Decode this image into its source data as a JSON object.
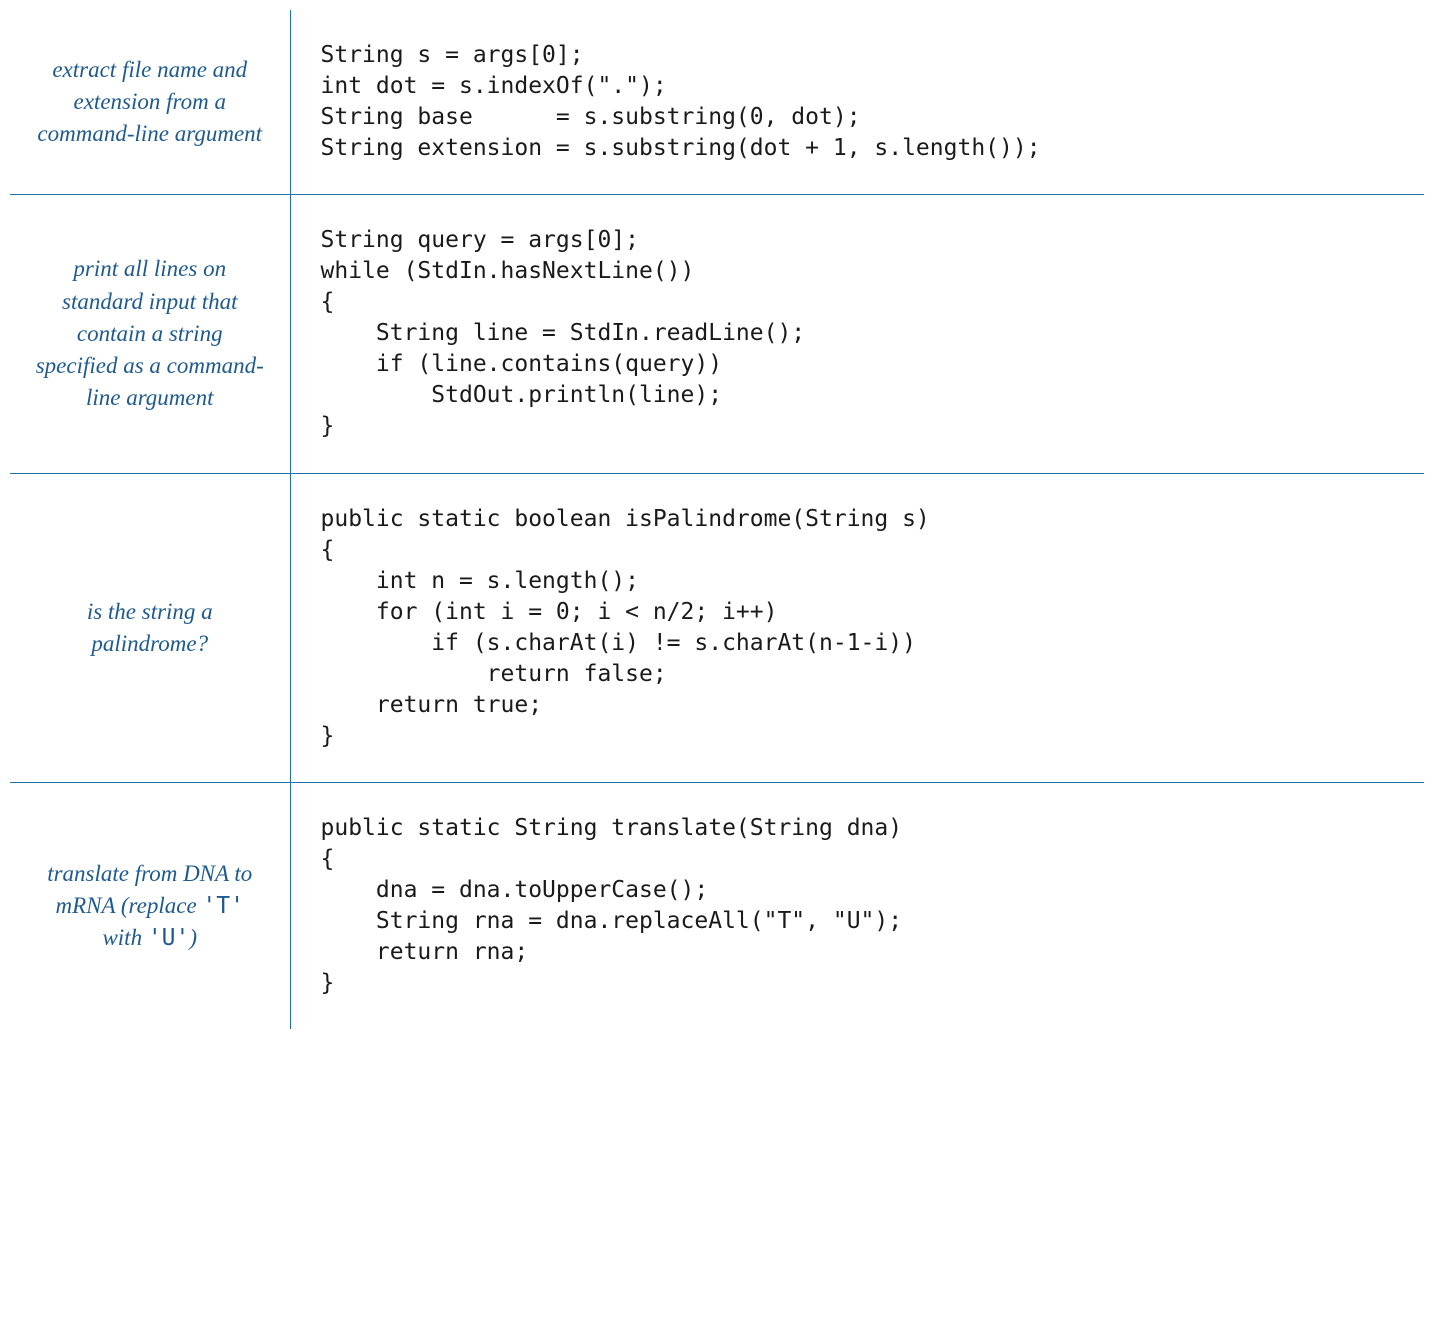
{
  "rows": [
    {
      "description": "extract file name and extension from a command-line argument",
      "code": "String s = args[0];\nint dot = s.indexOf(\".\");\nString base      = s.substring(0, dot);\nString extension = s.substring(dot + 1, s.length());"
    },
    {
      "description": "print all lines on standard input that contain a string specified as a command-line argument",
      "code": "String query = args[0];\nwhile (StdIn.hasNextLine())\n{\n    String line = StdIn.readLine();\n    if (line.contains(query))\n        StdOut.println(line);\n}"
    },
    {
      "description": "is the string a palindrome?",
      "code": "public static boolean isPalindrome(String s)\n{\n    int n = s.length();\n    for (int i = 0; i < n/2; i++)\n        if (s.charAt(i) != s.charAt(n-1-i))\n            return false;\n    return true;\n}"
    },
    {
      "description_parts": {
        "pre": "translate from DNA to mRNA (replace ",
        "t": "'T'",
        "mid": " with ",
        "u": "'U'",
        "post": ")"
      },
      "code": "public static String translate(String dna)\n{\n    dna = dna.toUpperCase();\n    String rna = dna.replaceAll(\"T\", \"U\");\n    return rna;\n}"
    }
  ]
}
